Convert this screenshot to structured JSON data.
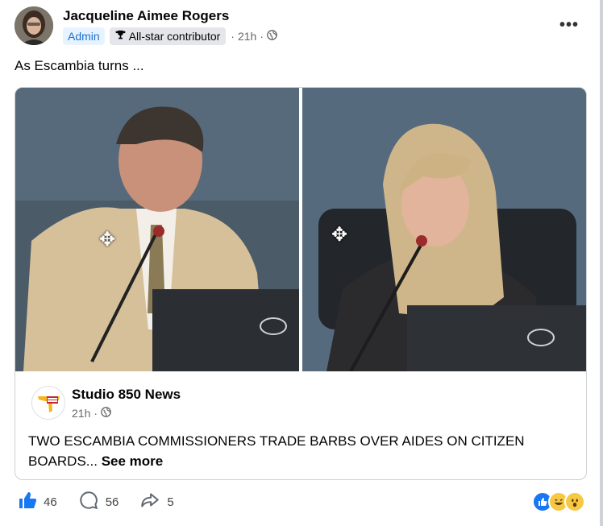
{
  "post": {
    "author": "Jacqueline Aimee Rogers",
    "badge_admin": "Admin",
    "badge_contributor": "All-star contributor",
    "time": "21h",
    "dot": "·",
    "text": "As Escambia turns ...",
    "more_icon": "more-horizontal-icon"
  },
  "shared": {
    "source_name": "Studio 850 News",
    "time": "21h",
    "dot": "·",
    "headline": "TWO ESCAMBIA COMMISSIONERS TRADE BARBS OVER AIDES ON CITIZEN BOARDS...",
    "see_more": "See more"
  },
  "actions": {
    "likes": "46",
    "comments": "56",
    "shares": "5"
  },
  "reaction_icons": [
    "like-icon",
    "haha-icon",
    "wow-icon"
  ],
  "colors": {
    "accent": "#1877f2",
    "muted": "#65676b"
  }
}
